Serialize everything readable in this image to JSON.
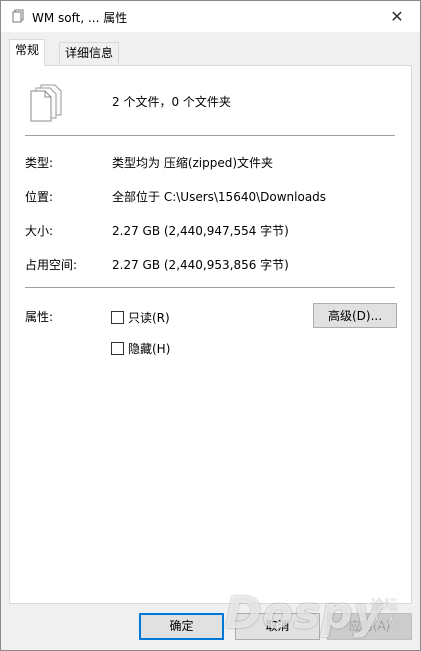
{
  "window": {
    "title": "WM soft, ... 属性",
    "close_glyph": "✕"
  },
  "tabs": [
    {
      "label": "常规",
      "active": true
    },
    {
      "label": "详细信息",
      "active": false
    }
  ],
  "summary": {
    "text": "2 个文件，0 个文件夹",
    "icon": "multiple-files-icon"
  },
  "props": {
    "type": {
      "label": "类型:",
      "value": "类型均为 压缩(zipped)文件夹"
    },
    "location": {
      "label": "位置:",
      "value": "全部位于 C:\\Users\\15640\\Downloads"
    },
    "size": {
      "label": "大小:",
      "value": "2.27 GB (2,440,947,554 字节)"
    },
    "disk": {
      "label": "占用空间:",
      "value": "2.27 GB (2,440,953,856 字节)"
    }
  },
  "attributes": {
    "label": "属性:",
    "readonly": {
      "label": "只读(R)",
      "checked": false
    },
    "hidden": {
      "label": "隐藏(H)",
      "checked": false
    },
    "advanced_label": "高级(D)..."
  },
  "buttons": {
    "ok": "确定",
    "cancel": "取消",
    "apply": "应用(A)"
  },
  "watermark": {
    "brand": "Dospy",
    "side": "论坛 人人"
  }
}
